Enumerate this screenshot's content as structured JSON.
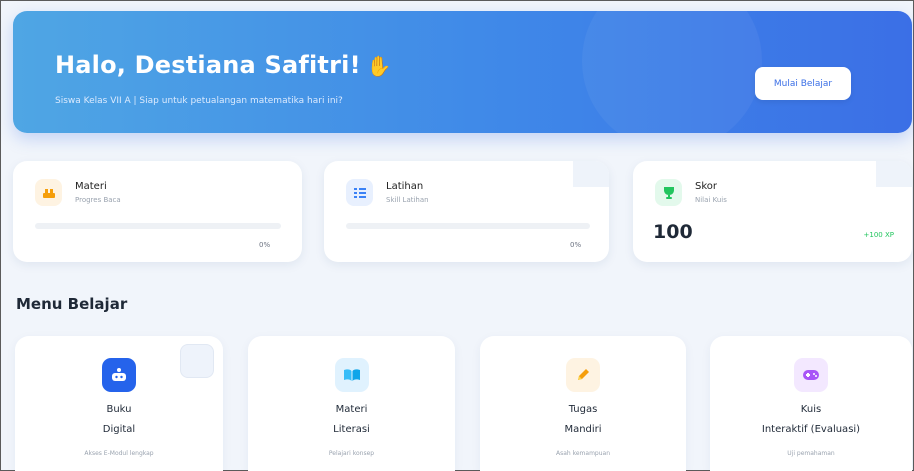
{
  "hero": {
    "greeting": "Halo, Destiana Safitri!",
    "subtitle": "Siswa Kelas VII A | Siap untuk petualangan matematika hari ini?",
    "start_button": "Mulai Belajar"
  },
  "stats": [
    {
      "label": "Materi",
      "sub": "Progres Baca",
      "percent_text": "0%",
      "progress": 0,
      "icon": "book-stack-icon",
      "color": "#f59e0b"
    },
    {
      "label": "Latihan",
      "sub": "Skill Latihan",
      "percent_text": "0%",
      "progress": 0,
      "icon": "list-icon",
      "color": "#3b82f6"
    },
    {
      "label": "Skor",
      "sub": "Nilai Kuis",
      "value": "100",
      "badge": "+100 XP",
      "icon": "trophy-icon",
      "color": "#22c55e"
    }
  ],
  "menu": {
    "title": "Menu Belajar",
    "items": [
      {
        "line1": "Buku",
        "line2": "Digital",
        "desc": "Akses E-Modul lengkap",
        "icon": "robot-icon",
        "color": "#2563eb"
      },
      {
        "line1": "Materi",
        "line2": "Literasi",
        "desc": "Pelajari konsep",
        "icon": "open-book-icon",
        "color": "#38bdf8"
      },
      {
        "line1": "Tugas",
        "line2": "Mandiri",
        "desc": "Asah kemampuan",
        "icon": "pencil-icon",
        "color": "#f59e0b"
      },
      {
        "line1": "Kuis",
        "line2": "Interaktif (Evaluasi)",
        "desc": "Uji pemahaman",
        "icon": "gamepad-icon",
        "color": "#a855f7"
      }
    ]
  }
}
